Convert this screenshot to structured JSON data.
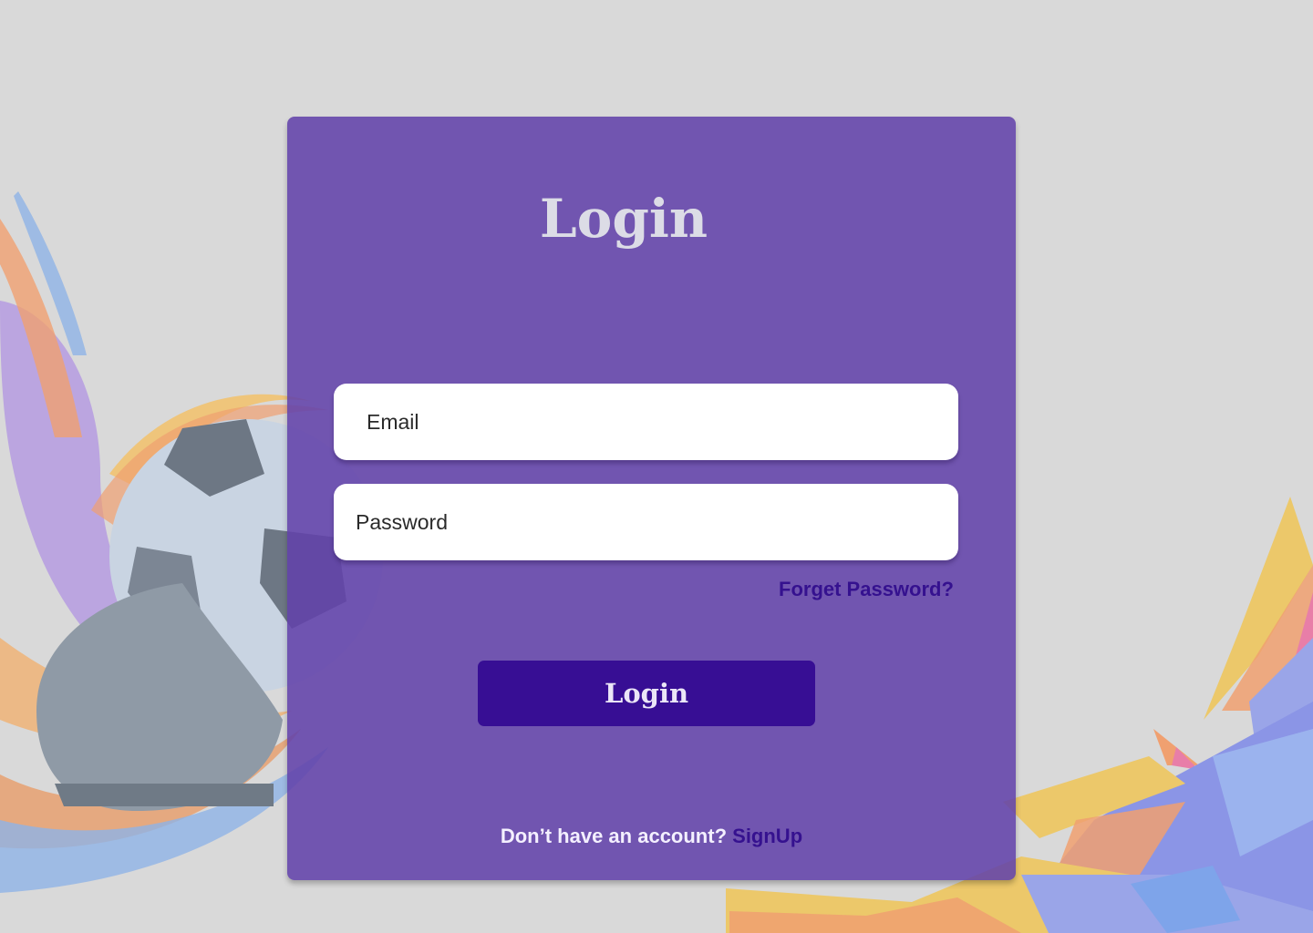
{
  "login": {
    "title": "Login",
    "email_placeholder": "Email",
    "password_placeholder": "Password",
    "forgot_password": "Forget Password?",
    "submit_label": "Login",
    "signup_prompt": "Don’t have an account?",
    "signup_link": "SignUp"
  },
  "colors": {
    "background": "#d9d9d9",
    "card": "#7157ae",
    "button": "#370e94",
    "link": "#35118f"
  },
  "decorations": {
    "left_art": "soccer-ball-and-boot-illustration",
    "right_art": "polygon-shards-decoration"
  }
}
